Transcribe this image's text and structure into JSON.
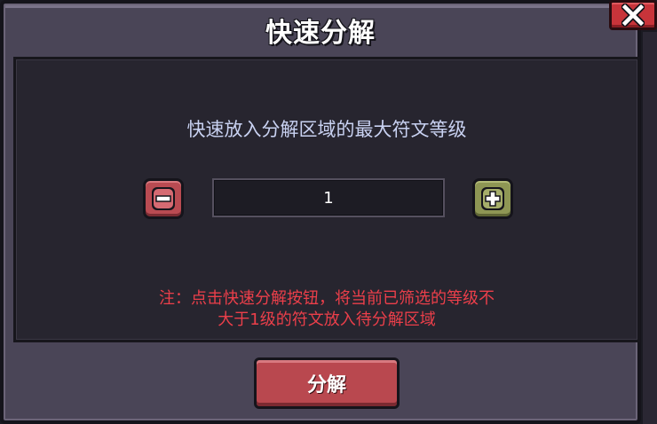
{
  "dialog": {
    "title": "快速分解",
    "close_icon": "close-icon"
  },
  "panel": {
    "label": "快速放入分解区域的最大符文等级",
    "level_value": "1",
    "minus_icon": "minus-icon",
    "plus_icon": "plus-icon",
    "note_line1": "注：点击快速分解按钮，将当前已筛选的等级不",
    "note_line2": "大于1级的符文放入待分解区域"
  },
  "actions": {
    "decompose_label": "分解"
  },
  "colors": {
    "dialog_bg": "#4a4557",
    "panel_bg": "#27252f",
    "label_text": "#c9d2f2",
    "note_text": "#ec3f4a",
    "button_red": "#b9484f",
    "button_green": "#8e9654",
    "close_red": "#c8343a"
  }
}
